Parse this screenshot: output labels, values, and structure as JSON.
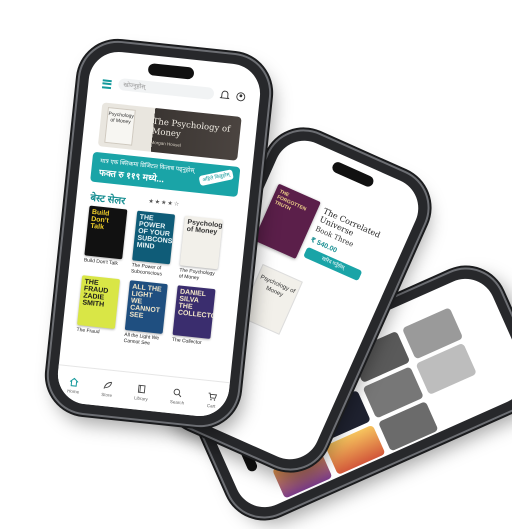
{
  "front_phone": {
    "search": {
      "placeholder": "खोज्नुहोस्"
    },
    "banner": {
      "cover_text": "Psychology of Money",
      "cover_author": "Morgan Housel",
      "title": "The Psychology of Money",
      "author": "Morgan Housel"
    },
    "promo": {
      "line1": "मात्र एक क्लिकमा डिजिटल किताब पढ्नुहोस्",
      "line2": "फक्त रु ११९ मध्ये...",
      "badge": "अहिले किन्नुहोस्"
    },
    "section_title": "बेस्ट सेलर",
    "rating": "★★★★☆",
    "books": [
      {
        "cover": "Build Don't Talk",
        "caption": "Build Don't Talk",
        "bg": "#111111",
        "fg": "#f3d22a"
      },
      {
        "cover": "THE POWER OF YOUR SUBCONSCIOUS MIND",
        "caption": "The Power of Subconscious",
        "bg": "#0f5c78",
        "fg": "#e6f2f5"
      },
      {
        "cover": "Psychology of Money",
        "caption": "The Psychology of Money",
        "bg": "#f2f0ea",
        "fg": "#333333"
      },
      {
        "cover": "THE FRAUD ZADIE SMITH",
        "caption": "The Fraud",
        "bg": "#d9e646",
        "fg": "#1a1a1a"
      },
      {
        "cover": "ALL THE LIGHT WE CANNOT SEE",
        "caption": "All the Light We Cannot See",
        "bg": "#1f4f80",
        "fg": "#f1e6c9"
      },
      {
        "cover": "DANIEL SILVA THE COLLECTOR",
        "caption": "The Collector",
        "bg": "#3a2d6e",
        "fg": "#f3e8c8"
      }
    ],
    "nav": [
      {
        "label": "Home",
        "icon": "home-icon"
      },
      {
        "label": "Store",
        "icon": "feather-icon"
      },
      {
        "label": "Library",
        "icon": "book-icon"
      },
      {
        "label": "Search",
        "icon": "search-icon"
      },
      {
        "label": "Cart",
        "icon": "cart-icon"
      }
    ]
  },
  "middle_phone": {
    "book_title": "The Correlated Universe",
    "book_subtitle": "Book Three",
    "price": "₹ 540.00",
    "button": "खरिद गर्नुहोस्",
    "cover_text": "THE FORGOTTEN TRUTH",
    "second_book": "Psychology of Money"
  },
  "back_phone": {
    "tiles": 10
  },
  "colors": {
    "accent": "#1aa4a7",
    "frame": "#27282b",
    "bezel": "#6c6e73"
  }
}
